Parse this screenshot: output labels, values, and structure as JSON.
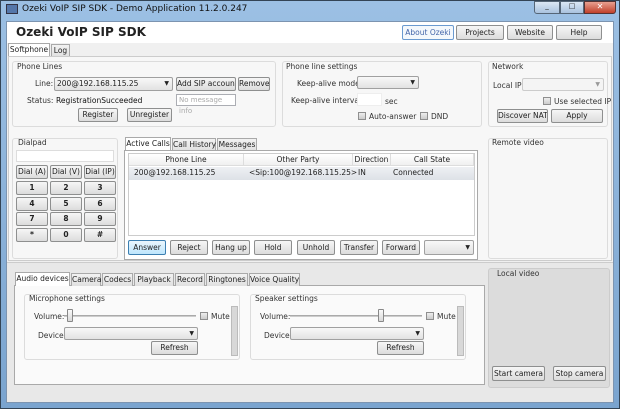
{
  "window": {
    "title": "Ozeki VoIP SIP SDK - Demo Application 11.2.0.247"
  },
  "header": {
    "app_title": "Ozeki VoIP SIP SDK",
    "buttons": [
      "About Ozeki",
      "Projects",
      "Website",
      "Help"
    ]
  },
  "main_tabs": [
    "Softphone",
    "Log"
  ],
  "phone_lines": {
    "title": "Phone Lines",
    "line_label": "Line:",
    "line_value": "200@192.168.115.25",
    "add_label": "Add SIP account",
    "remove_label": "Remove",
    "status_label": "Status:",
    "status_value": "RegistrationSucceeded",
    "message_info": "No message info",
    "register_label": "Register",
    "unregister_label": "Unregister"
  },
  "line_settings": {
    "title": "Phone line settings",
    "keepalive_mode_label": "Keep-alive mode:",
    "keepalive_mode_value": "",
    "keepalive_interval_label": "Keep-alive interval:",
    "keepalive_interval_value": "",
    "sec": "sec",
    "auto_answer": "Auto-answer",
    "dnd": "DND"
  },
  "network": {
    "title": "Network",
    "local_ip_label": "Local IP:",
    "local_ip_value": "",
    "use_selected_ip": "Use selected IP",
    "discover_nat": "Discover NAT",
    "apply": "Apply"
  },
  "dialpad": {
    "title": "Dialpad",
    "input": "",
    "dial_buttons": [
      "Dial (A)",
      "Dial (V)",
      "Dial (IP)"
    ],
    "keys": [
      "1",
      "2",
      "3",
      "4",
      "5",
      "6",
      "7",
      "8",
      "9",
      "*",
      "0",
      "#"
    ]
  },
  "calls": {
    "tabs": [
      "Active Calls",
      "Call History",
      "Messages"
    ],
    "columns": [
      "Phone Line",
      "Other Party",
      "Direction",
      "Call State"
    ],
    "rows": [
      {
        "phone_line": "200@192.168.115.25",
        "other_party": "<Sip:100@192.168.115.25>",
        "direction": "IN",
        "state": "Connected"
      }
    ],
    "actions": [
      "Answer",
      "Reject",
      "Hang up",
      "Hold",
      "Unhold",
      "Transfer",
      "Forward"
    ],
    "forward_target": ""
  },
  "remote_video": {
    "title": "Remote video"
  },
  "settings_tabs": [
    "Audio devices",
    "Camera",
    "Codecs",
    "Playback",
    "Record",
    "Ringtones",
    "Voice Quality"
  ],
  "microphone": {
    "title": "Microphone settings",
    "volume_label": "Volume:",
    "volume": 0.02,
    "mute": "Mute",
    "device_label": "Device:",
    "device": "",
    "refresh": "Refresh"
  },
  "speaker": {
    "title": "Speaker settings",
    "volume_label": "Volume:",
    "volume": 0.7,
    "mute": "Mute",
    "device_label": "Device:",
    "device": "",
    "refresh": "Refresh"
  },
  "local_video": {
    "title": "Local video",
    "start": "Start camera",
    "stop": "Stop camera"
  }
}
